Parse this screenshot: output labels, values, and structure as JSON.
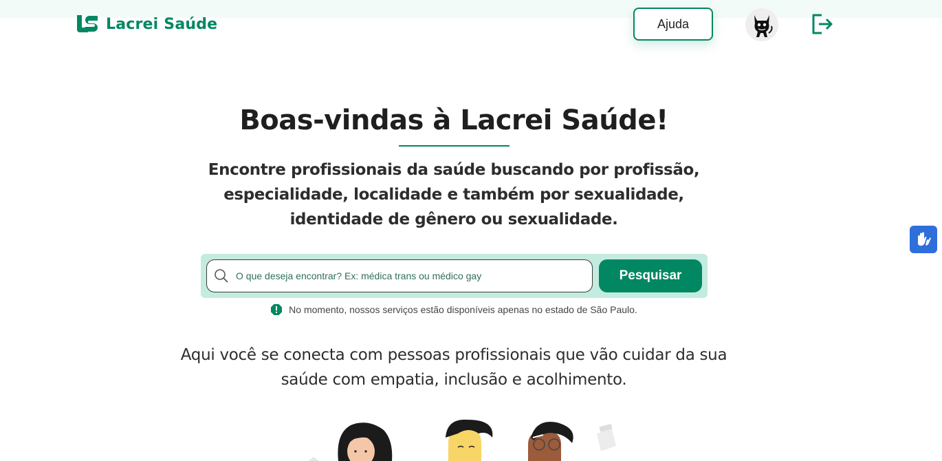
{
  "header": {
    "logo_text": "Lacrei Saúde",
    "help_label": "Ajuda",
    "avatar_icon": "cat-avatar-icon",
    "logout_icon": "logout-icon"
  },
  "hero": {
    "title": "Boas-vindas à Lacrei Saúde!",
    "subtitle": "Encontre profissionais da saúde buscando por profissão, especialidade, localidade e também por sexualidade, identidade de gênero ou sexualidade."
  },
  "search": {
    "placeholder": "O que deseja encontrar? Ex: médica trans ou médico gay",
    "button_label": "Pesquisar",
    "notice": "No momento, nossos serviços estão disponíveis apenas no estado de São Paulo."
  },
  "tagline": "Aqui você se conecta com pessoas profissionais que vão cuidar da sua saúde com empatia, inclusão e acolhimento.",
  "accessibility": {
    "icon": "sign-language-hands-icon"
  },
  "colors": {
    "brand": "#018762",
    "search_bg": "#c4ebdf",
    "a11y": "#2f6fdc"
  }
}
